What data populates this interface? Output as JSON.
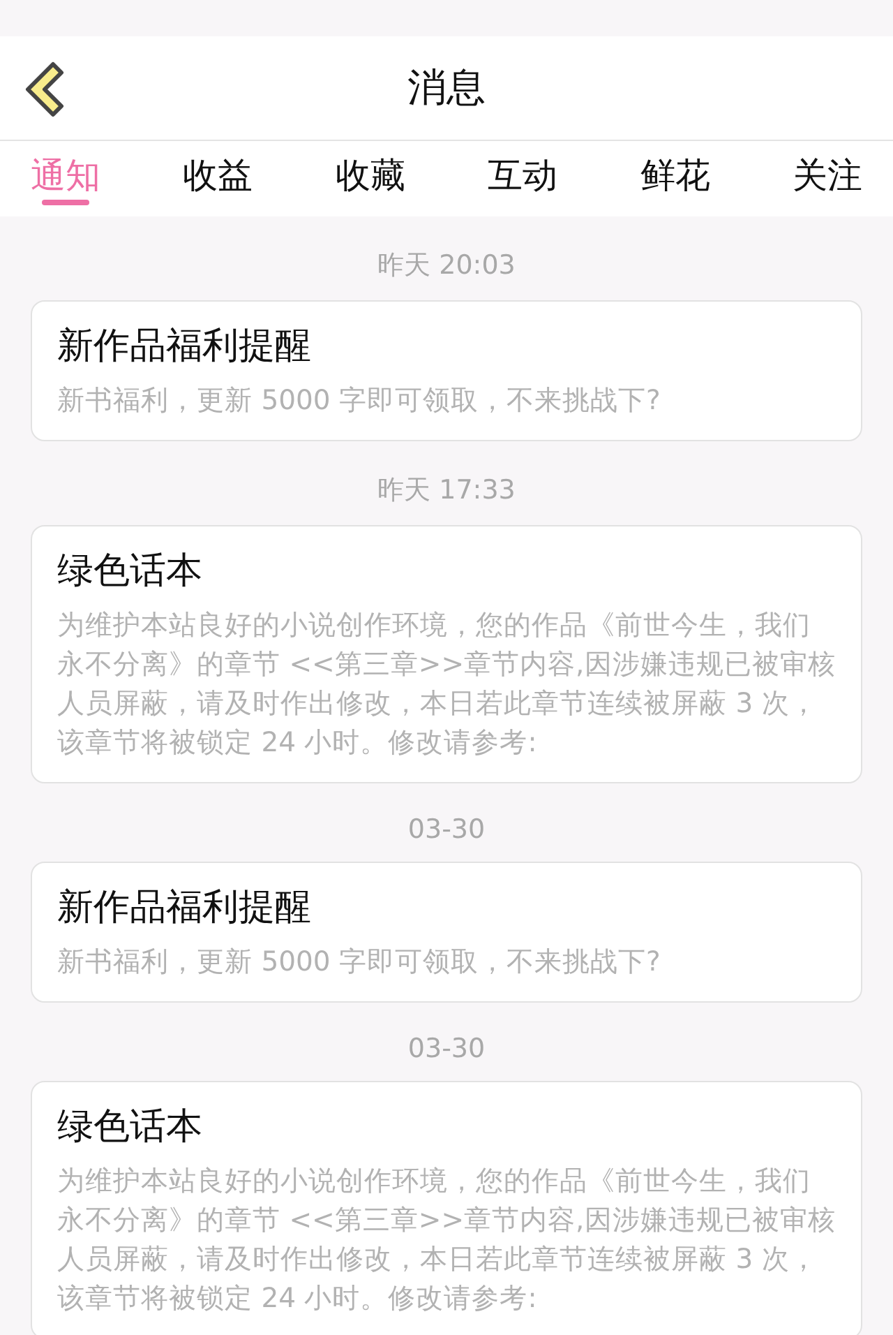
{
  "header": {
    "title": "消息"
  },
  "tabs": [
    {
      "label": "通知",
      "selected": true
    },
    {
      "label": "收益",
      "selected": false
    },
    {
      "label": "收藏",
      "selected": false
    },
    {
      "label": "互动",
      "selected": false
    },
    {
      "label": "鲜花",
      "selected": false
    },
    {
      "label": "关注",
      "selected": false
    }
  ],
  "messages": [
    {
      "time": "昨天 20:03",
      "title": "新作品福利提醒",
      "body": "新书福利，更新 5000 字即可领取，不来挑战下?"
    },
    {
      "time": "昨天 17:33",
      "title": "绿色话本",
      "body": "为维护本站良好的小说创作环境，您的作品《前世今生，我们永不分离》的章节 <<第三章>>章节内容,因涉嫌违规已被审核人员屏蔽，请及时作出修改，本日若此章节连续被屏蔽 3 次，该章节将被锁定 24 小时。修改请参考:"
    },
    {
      "time": "03-30",
      "title": "新作品福利提醒",
      "body": "新书福利，更新 5000 字即可领取，不来挑战下?"
    },
    {
      "time": "03-30",
      "title": "绿色话本",
      "body": "为维护本站良好的小说创作环境，您的作品《前世今生，我们永不分离》的章节 <<第三章>>章节内容,因涉嫌违规已被审核人员屏蔽，请及时作出修改，本日若此章节连续被屏蔽 3 次，该章节将被锁定 24 小时。修改请参考:"
    }
  ]
}
